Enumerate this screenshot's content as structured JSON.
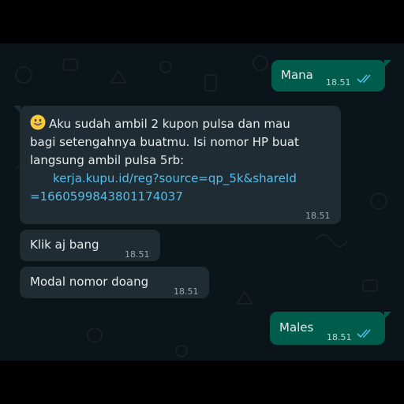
{
  "messages": [
    {
      "direction": "outgoing",
      "text": "Mana",
      "time": "18.51",
      "status": "read"
    },
    {
      "direction": "incoming",
      "text_lines": [
        "Aku sudah ambil 2 kupon pulsa dan mau",
        "bagi setengahnya buatmu. Isi nomor HP buat",
        "langsung ambil pulsa 5rb:"
      ],
      "link_lines": [
        "kerja.kupu.id/reg?source=qp_5k&shareId",
        "=1660599843801174037"
      ],
      "emoji": "grinning-face",
      "time": "18.51"
    },
    {
      "direction": "incoming",
      "text": "Klik aj bang",
      "time": "18.51"
    },
    {
      "direction": "incoming",
      "text": "Modal nomor doang",
      "time": "18.51"
    },
    {
      "direction": "outgoing",
      "text": "Males",
      "time": "18.51",
      "status": "read"
    }
  ],
  "colors": {
    "chat_background": "#0b1419",
    "incoming_bubble": "#1f2c33",
    "outgoing_bubble": "#005c4b",
    "link": "#53bdeb",
    "read_ticks": "#53bdeb"
  }
}
